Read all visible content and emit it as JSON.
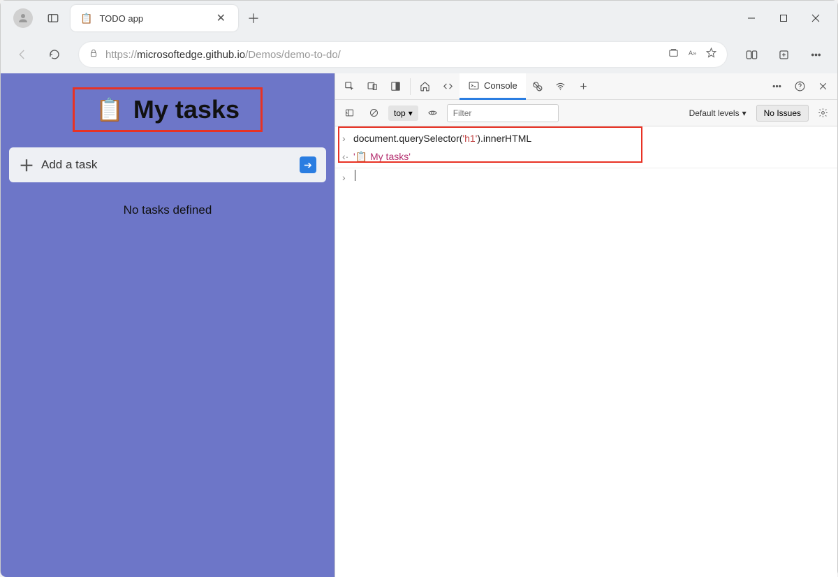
{
  "browser": {
    "tab": {
      "favicon": "📋",
      "title": "TODO app"
    },
    "url": {
      "protocol": "https://",
      "host": "microsoftedge.github.io",
      "path": "/Demos/demo-to-do/"
    }
  },
  "app": {
    "heading_icon": "📋",
    "heading": "My tasks",
    "add_placeholder": "Add a task",
    "no_tasks_text": "No tasks defined"
  },
  "devtools": {
    "tabs": {
      "console": "Console"
    },
    "toolbar": {
      "context": "top",
      "filter_placeholder": "Filter",
      "levels": "Default levels",
      "issues": "No Issues"
    },
    "console": {
      "input": "document.querySelector('h1').innerHTML",
      "input_arg": "'h1'",
      "output_prefix": "'📋 ",
      "output_text": "My tasks",
      "output_suffix": "'"
    }
  }
}
